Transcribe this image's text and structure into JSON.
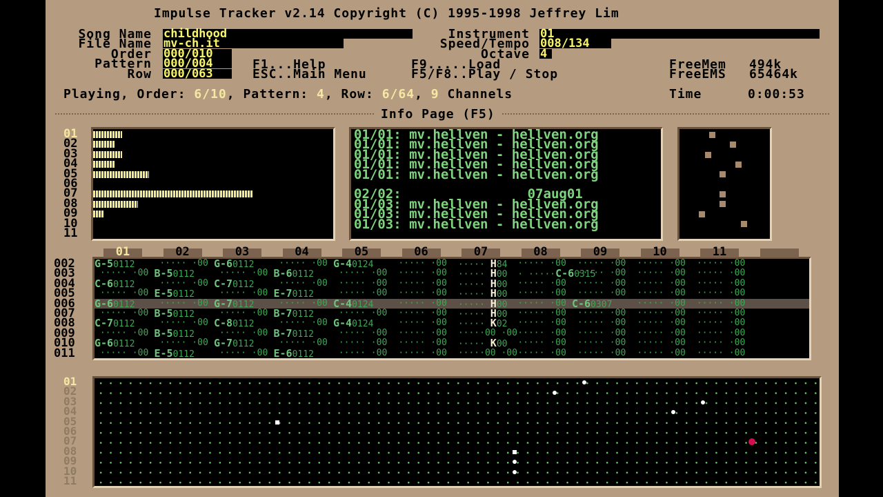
{
  "app": {
    "title": "Impulse Tracker v2.14 Copyright (C) 1995-1998 Jeffrey Lim"
  },
  "song": {
    "song_name_label": "Song Name",
    "song_name": "childhood",
    "file_name_label": "File Name",
    "file_name": "mv-ch.it",
    "order_label": "Order",
    "order": "000/010",
    "pattern_label": "Pattern",
    "pattern": "000/004",
    "row_label": "Row",
    "row": "000/063",
    "instrument_label": "Instrument",
    "instrument": "01",
    "speed_tempo_label": "Speed/Tempo",
    "speed_tempo": "008/134",
    "octave_label": "Octave",
    "octave": "4"
  },
  "help": {
    "f1": "F1...Help",
    "esc": "ESC..Main Menu",
    "f9": "F9.....Load",
    "f5f8": "F5/F8..Play / Stop"
  },
  "memory": {
    "freemem_label": "FreeMem",
    "freemem": "494k",
    "freeems_label": "FreeEMS",
    "freeems": "65464k"
  },
  "status": {
    "playing": "Playing, Order:",
    "order_val": "6/10",
    "pattern_label": ", Pattern:",
    "pattern_val": "4",
    "row_label": ", Row:",
    "row_val": "6/64",
    "sep": ",",
    "channels_val": "9",
    "channels_label": "Channels",
    "time_label": "Time",
    "time_val": "0:00:53"
  },
  "page_title": "Info Page (F5)",
  "channels": [
    "01",
    "02",
    "03",
    "04",
    "05",
    "06",
    "07",
    "08",
    "09",
    "10",
    "11"
  ],
  "vu_levels": [
    0.18,
    0.14,
    0.18,
    0.14,
    0.35,
    0,
    1.0,
    0.28,
    0.07,
    0,
    0
  ],
  "samples": [
    "01/01: mv.hellven - hellven.org",
    "01/01: mv.hellven - hellven.org",
    "01/01: mv.hellven - hellven.org",
    "01/01: mv.hellven - hellven.org",
    "01/01: mv.hellven - hellven.org",
    "",
    "02/02:                07aug01",
    "01/03: mv.hellven - hellven.org",
    "01/03: mv.hellven - hellven.org",
    "01/03: mv.hellven - hellven.org"
  ],
  "pattern_rows": [
    "002",
    "003",
    "004",
    "005",
    "006",
    "007",
    "008",
    "009",
    "010",
    "011"
  ],
  "pattern_cells": [
    [
      "G-50112",
      "·····",
      "G-60112",
      "·····",
      "G-40124",
      "·····",
      "·····H84",
      "·····",
      "·····",
      "·····",
      "·····"
    ],
    [
      "·····",
      "B-50112",
      "·····",
      "B-60112",
      "·····",
      "·····",
      "·····H00",
      "·····C-60315",
      "·····",
      "·····",
      "·····"
    ],
    [
      "C-60112",
      "·····",
      "C-70112",
      "·····",
      "·····",
      "·····",
      "·····H00",
      "·····",
      "·····",
      "·····",
      "·····"
    ],
    [
      "·····",
      "E-50112",
      "·····",
      "E-70112",
      "·····",
      "·····",
      "·····H00",
      "·····",
      "·····",
      "·····",
      "·····"
    ],
    [
      "G-60112",
      "·····",
      "G-70112",
      "·····",
      "C-40124",
      "·····",
      "·····H00",
      "·····",
      "C-60307",
      "·····",
      "·····"
    ],
    [
      "·····",
      "B-50112",
      "·····",
      "B-70112",
      "·····",
      "·····",
      "·····H00",
      "·····",
      "·····",
      "·····",
      "·····"
    ],
    [
      "C-70112",
      "·····",
      "C-80112",
      "·····",
      "G-40124",
      "·····",
      "·····K02",
      "·····",
      "·····",
      "·····",
      "·····"
    ],
    [
      "·····",
      "B-50112",
      "·····",
      "B-70112",
      "·····",
      "·····",
      "·····00",
      "·····",
      "·····",
      "·····",
      "·····"
    ],
    [
      "G-60112",
      "·····",
      "G-70112",
      "·····",
      "·····",
      "·····",
      "·····K00",
      "·····",
      "·····",
      "·····",
      "·····"
    ],
    [
      "·····",
      "E-50112",
      "·····",
      "E-60112",
      "·····",
      "·····",
      "·····00",
      "·····",
      "·····",
      "·····",
      "·····"
    ]
  ],
  "grid_channels": [
    "01",
    "02",
    "03",
    "04",
    "05",
    "06",
    "07",
    "08",
    "09",
    "10",
    "11"
  ],
  "colors": {
    "background": "#b59c80",
    "field_text": "#f8f56c",
    "sample_text": "#7fd47f",
    "note_text": "#6fc37c"
  }
}
